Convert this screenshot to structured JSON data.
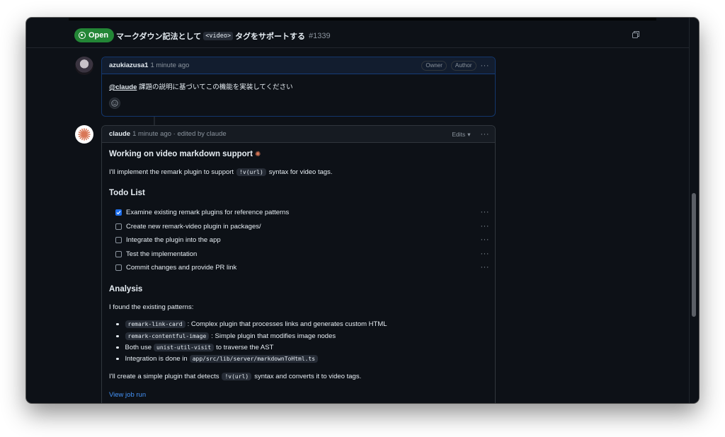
{
  "header": {
    "status": "Open",
    "title_before": "マークダウン記法として",
    "title_code": "<video>",
    "title_after": "タグをサポートする",
    "number": "#1339"
  },
  "comment1": {
    "author": "azukiazusa1",
    "time": "1 minute ago",
    "badges": [
      "Owner",
      "Author"
    ],
    "mention": "@claude",
    "text": "課題の説明に基づいてこの機能を実装してください"
  },
  "comment2": {
    "author": "claude",
    "meta": "1 minute ago · edited by claude",
    "edits_label": "Edits",
    "heading": "Working on video markdown support",
    "intro_before": "I'll implement the remark plugin to support",
    "intro_code": "!v(url)",
    "intro_after": "syntax for video tags.",
    "todo_heading": "Todo List",
    "todos": [
      {
        "label": "Examine existing remark plugins for reference patterns",
        "checked": true
      },
      {
        "label": "Create new remark-video plugin in packages/",
        "checked": false
      },
      {
        "label": "Integrate the plugin into the app",
        "checked": false
      },
      {
        "label": "Test the implementation",
        "checked": false
      },
      {
        "label": "Commit changes and provide PR link",
        "checked": false
      }
    ],
    "analysis_heading": "Analysis",
    "analysis_intro": "I found the existing patterns:",
    "bullets": [
      {
        "code": "remark-link-card",
        "text": ": Complex plugin that processes links and generates custom HTML"
      },
      {
        "code": "remark-contentful-image",
        "text": ": Simple plugin that modifies image nodes"
      },
      {
        "before": "Both use",
        "code": "unist-util-visit",
        "text": "to traverse the AST"
      },
      {
        "before": "Integration is done in",
        "code": "app/src/lib/server/markdownToHtml.ts",
        "text": ""
      }
    ],
    "closing_before": "I'll create a simple plugin that detects",
    "closing_code": "!v(url)",
    "closing_after": "syntax and converts it to video tags.",
    "link": "View job run"
  },
  "colors": {
    "background": "#0d1117",
    "open_badge": "#238636",
    "link": "#4493f8",
    "checkbox_checked": "#1f6feb",
    "claude_accent": "#d97757"
  }
}
